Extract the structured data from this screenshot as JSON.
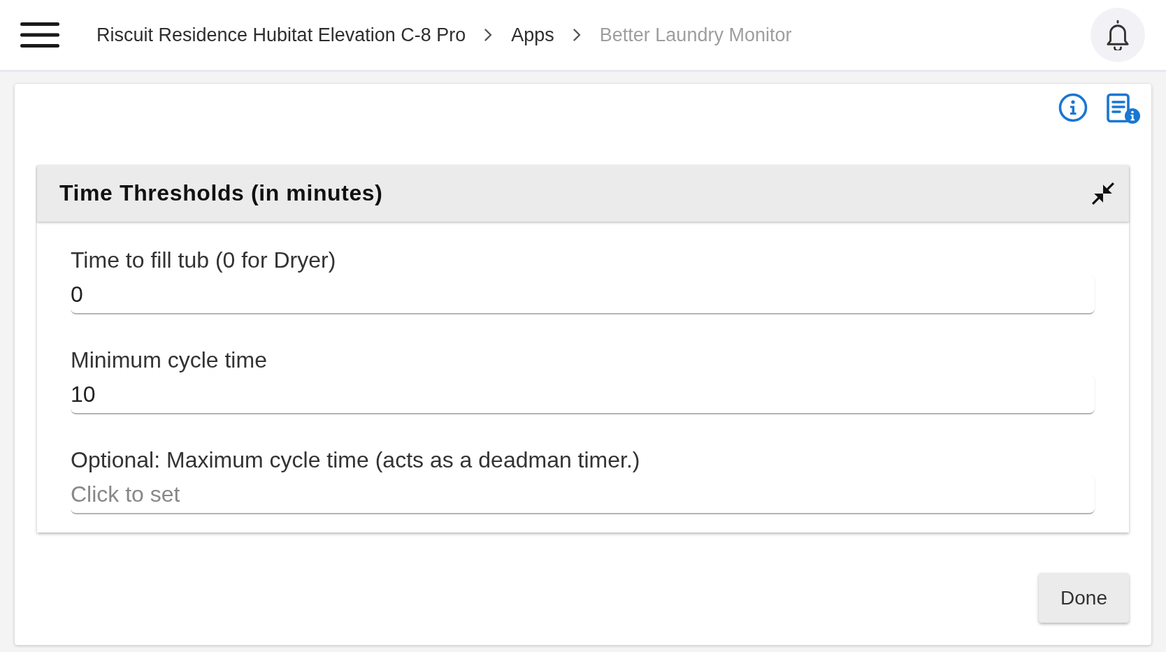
{
  "top_bar": {
    "breadcrumbs": [
      {
        "label": "Riscuit Residence Hubitat Elevation C-8 Pro",
        "current": false
      },
      {
        "label": "Apps",
        "current": false
      },
      {
        "label": "Better Laundry Monitor",
        "current": true
      }
    ]
  },
  "section": {
    "title": "Time Thresholds (in minutes)",
    "expanded": true,
    "fields": [
      {
        "label": "Time to fill tub (0 for Dryer)",
        "value": "0"
      },
      {
        "label": "Minimum cycle time",
        "value": "10"
      },
      {
        "label": "Optional: Maximum cycle time (acts as a deadman timer.)",
        "placeholder": "Click to set"
      }
    ]
  },
  "buttons": [
    "Done"
  ]
}
